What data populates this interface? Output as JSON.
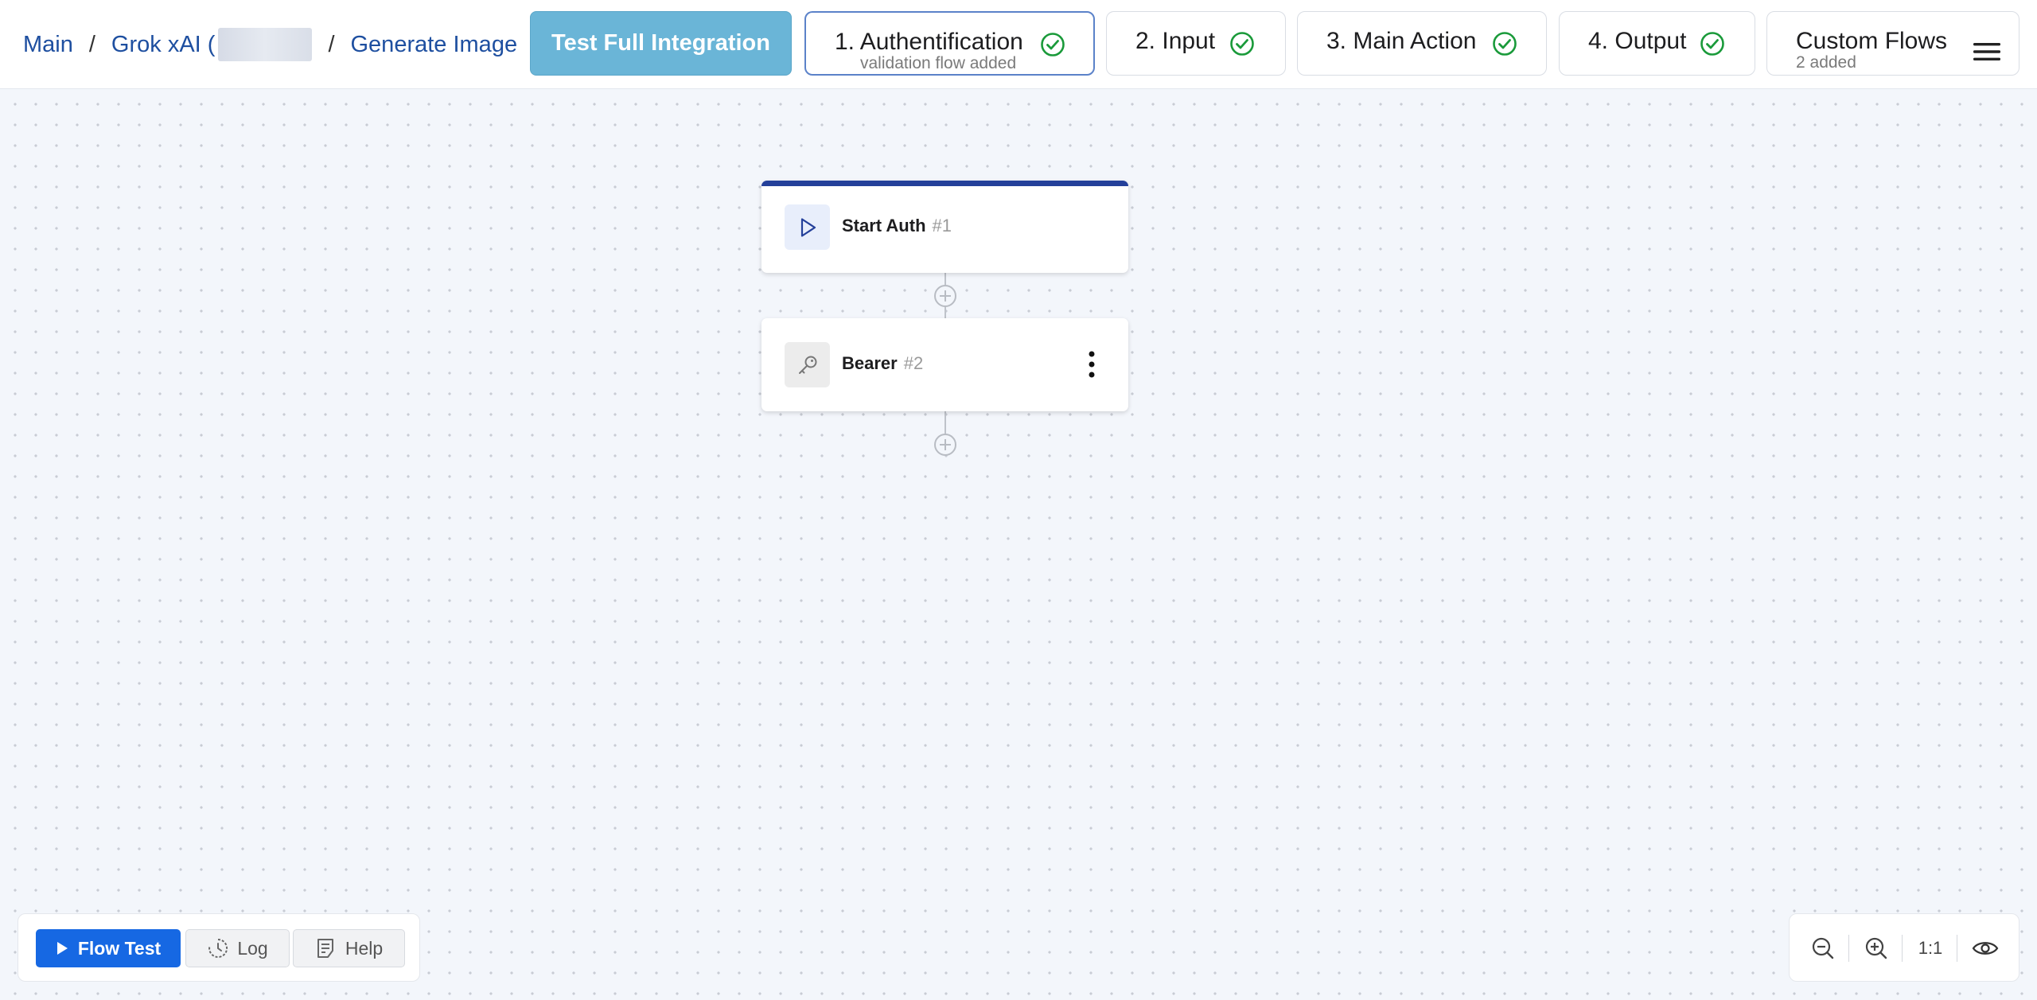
{
  "breadcrumb": {
    "main": "Main",
    "separator": "/",
    "integration": "Grok xAI (",
    "action": "Generate Image"
  },
  "header": {
    "test_button": "Test Full Integration",
    "steps": [
      {
        "label": "1. Authentification",
        "sub": "validation flow added",
        "status_icon": "check-circle-icon",
        "active": true
      },
      {
        "label": "2. Input",
        "status_icon": "check-circle-icon",
        "active": false
      },
      {
        "label": "3. Main Action",
        "status_icon": "check-circle-icon",
        "active": false
      },
      {
        "label": "4. Output",
        "status_icon": "check-circle-icon",
        "active": false
      }
    ],
    "custom_flows": {
      "label": "Custom Flows",
      "sub": "2 added",
      "icon": "menu-icon"
    }
  },
  "flow": {
    "nodes": [
      {
        "title": "Start Auth",
        "num": "#1",
        "icon": "play-icon"
      },
      {
        "title": "Bearer",
        "num": "#2",
        "icon": "key-icon"
      }
    ]
  },
  "toolbar": {
    "flow_test": "Flow Test",
    "log": "Log",
    "help": "Help"
  },
  "zoom": {
    "reset_label": "1:1"
  },
  "colors": {
    "accent_blue": "#1668e3",
    "test_button": "#6ab5d7",
    "start_node_top": "#24409a",
    "success_green": "#1a9a3a",
    "link_blue": "#1e4fa0",
    "canvas_bg": "#f3f6fb"
  }
}
